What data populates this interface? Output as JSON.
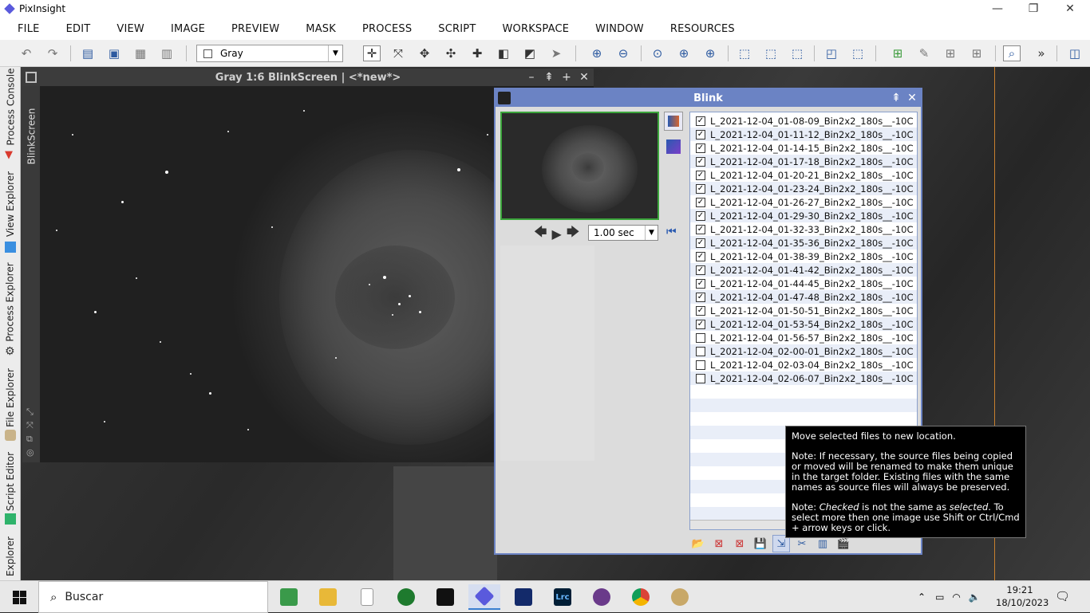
{
  "app": {
    "title": "PixInsight"
  },
  "window_controls": {
    "minimize": "—",
    "restore": "❐",
    "close": "✕"
  },
  "menu": [
    "FILE",
    "EDIT",
    "VIEW",
    "IMAGE",
    "PREVIEW",
    "MASK",
    "PROCESS",
    "SCRIPT",
    "WORKSPACE",
    "WINDOW",
    "RESOURCES"
  ],
  "toolbar": {
    "color_space": "Gray"
  },
  "left_tabs": [
    "Process Console",
    "View Explorer",
    "Process Explorer",
    "File Explorer",
    "Script Editor",
    "Explorer"
  ],
  "image_window": {
    "title": "Gray 1:6 BlinkScreen | <*new*>",
    "side_tab": "BlinkScreen"
  },
  "blink": {
    "title": "Blink",
    "delay": "1.00 sec",
    "files": [
      {
        "name": "L_2021-12-04_01-08-09_Bin2x2_180s__-10C",
        "checked": true
      },
      {
        "name": "L_2021-12-04_01-11-12_Bin2x2_180s__-10C",
        "checked": true
      },
      {
        "name": "L_2021-12-04_01-14-15_Bin2x2_180s__-10C",
        "checked": true
      },
      {
        "name": "L_2021-12-04_01-17-18_Bin2x2_180s__-10C",
        "checked": true
      },
      {
        "name": "L_2021-12-04_01-20-21_Bin2x2_180s__-10C",
        "checked": true
      },
      {
        "name": "L_2021-12-04_01-23-24_Bin2x2_180s__-10C",
        "checked": true
      },
      {
        "name": "L_2021-12-04_01-26-27_Bin2x2_180s__-10C",
        "checked": true
      },
      {
        "name": "L_2021-12-04_01-29-30_Bin2x2_180s__-10C",
        "checked": true
      },
      {
        "name": "L_2021-12-04_01-32-33_Bin2x2_180s__-10C",
        "checked": true
      },
      {
        "name": "L_2021-12-04_01-35-36_Bin2x2_180s__-10C",
        "checked": true
      },
      {
        "name": "L_2021-12-04_01-38-39_Bin2x2_180s__-10C",
        "checked": true
      },
      {
        "name": "L_2021-12-04_01-41-42_Bin2x2_180s__-10C",
        "checked": true
      },
      {
        "name": "L_2021-12-04_01-44-45_Bin2x2_180s__-10C",
        "checked": true
      },
      {
        "name": "L_2021-12-04_01-47-48_Bin2x2_180s__-10C",
        "checked": true
      },
      {
        "name": "L_2021-12-04_01-50-51_Bin2x2_180s__-10C",
        "checked": true
      },
      {
        "name": "L_2021-12-04_01-53-54_Bin2x2_180s__-10C",
        "checked": true
      },
      {
        "name": "L_2021-12-04_01-56-57_Bin2x2_180s__-10C",
        "checked": false
      },
      {
        "name": "L_2021-12-04_02-00-01_Bin2x2_180s__-10C",
        "checked": false
      },
      {
        "name": "L_2021-12-04_02-03-04_Bin2x2_180s__-10C",
        "checked": false
      },
      {
        "name": "L_2021-12-04_02-06-07_Bin2x2_180s__-10C",
        "checked": false
      }
    ]
  },
  "tooltip": {
    "line1": "Move selected files to new location.",
    "line2": "Note: If necessary, the source files being copied or moved will be renamed to make them unique in the target folder. Existing files with the same names as source files will always be preserved.",
    "line3_a": "Note: ",
    "line3_em1": "Checked",
    "line3_b": " is not the same as ",
    "line3_em2": "selected",
    "line3_c": ". To select more then one image use Shift or Ctrl/Cmd + arrow keys or click."
  },
  "taskbar": {
    "search_placeholder": "Buscar",
    "time": "19:21",
    "date": "18/10/2023",
    "lrc_label": "Lrc"
  }
}
